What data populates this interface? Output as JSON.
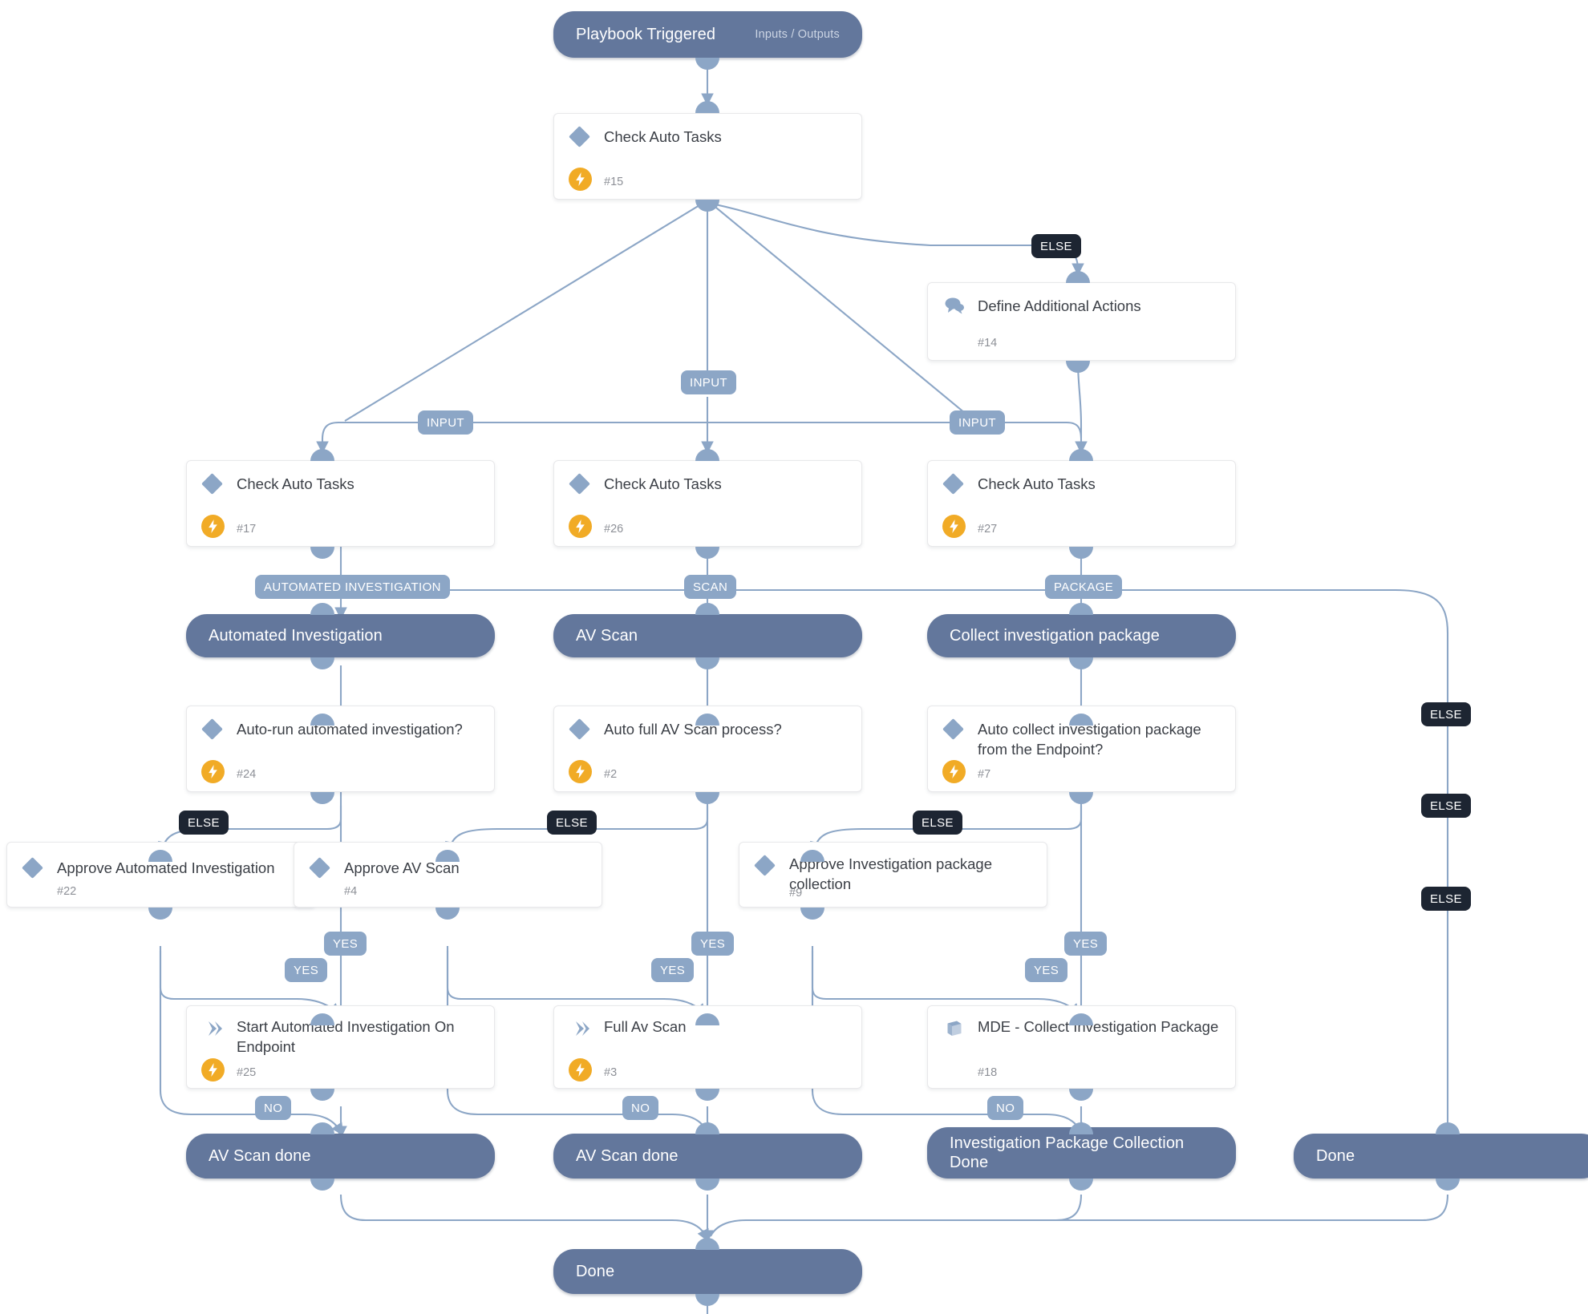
{
  "diagram": {
    "title": "Playbook Triggered",
    "type": "playbook-flow",
    "colors": {
      "pill_fill": "#63779c",
      "card_fill": "#ffffff",
      "port": "#8ca6c6",
      "edge": "#8ca6c6",
      "label_blue": "#8ca6c6",
      "label_dark": "#1d2532",
      "auto_badge": "#f1ab26"
    }
  },
  "nodes": {
    "trigger": {
      "label": "Playbook Triggered",
      "sub": "Inputs / Outputs",
      "kind": "pill"
    },
    "check15": {
      "label": "Check Auto Tasks",
      "id": "#15",
      "icon": "diamond-icon",
      "auto": true,
      "kind": "card"
    },
    "define14": {
      "label": "Define Additional Actions",
      "id": "#14",
      "icon": "speech-bubble-icon",
      "auto": false,
      "kind": "card"
    },
    "check17": {
      "label": "Check Auto Tasks",
      "id": "#17",
      "icon": "diamond-icon",
      "auto": true,
      "kind": "card"
    },
    "check26": {
      "label": "Check Auto Tasks",
      "id": "#26",
      "icon": "diamond-icon",
      "auto": true,
      "kind": "card"
    },
    "check27": {
      "label": "Check Auto Tasks",
      "id": "#27",
      "icon": "diamond-icon",
      "auto": true,
      "kind": "card"
    },
    "sec_ai": {
      "label": "Automated Investigation",
      "kind": "pill"
    },
    "sec_av": {
      "label": "AV Scan",
      "kind": "pill"
    },
    "sec_pkg": {
      "label": "Collect investigation package",
      "kind": "pill"
    },
    "cond24": {
      "label": "Auto-run automated investigation?",
      "id": "#24",
      "icon": "diamond-icon",
      "auto": true,
      "kind": "card"
    },
    "cond2": {
      "label": "Auto full AV Scan process?",
      "id": "#2",
      "icon": "diamond-icon",
      "auto": true,
      "kind": "card"
    },
    "cond7": {
      "label": "Auto collect investigation package from the Endpoint?",
      "id": "#7",
      "icon": "diamond-icon",
      "auto": true,
      "kind": "card"
    },
    "appr22": {
      "label": "Approve Automated Investigation",
      "id": "#22",
      "icon": "diamond-icon",
      "auto": false,
      "kind": "card"
    },
    "appr4": {
      "label": "Approve AV Scan",
      "id": "#4",
      "icon": "diamond-icon",
      "auto": false,
      "kind": "card"
    },
    "appr9": {
      "label": "Approve Investigation package collection",
      "id": "#9",
      "icon": "diamond-icon",
      "auto": false,
      "kind": "card"
    },
    "act25": {
      "label": "Start Automated Investigation On Endpoint",
      "id": "#25",
      "icon": "chevron-icon",
      "auto": true,
      "kind": "card"
    },
    "act3": {
      "label": "Full Av Scan",
      "id": "#3",
      "icon": "chevron-icon",
      "auto": true,
      "kind": "card"
    },
    "act18": {
      "label": "MDE - Collect Investigation Package",
      "id": "#18",
      "icon": "book-icon",
      "auto": false,
      "kind": "card"
    },
    "done_ai": {
      "label": "AV Scan done",
      "kind": "pill"
    },
    "done_av": {
      "label": "AV Scan done",
      "kind": "pill"
    },
    "done_pkg": {
      "label": "Investigation Package Collection\nDone",
      "kind": "pill"
    },
    "done_right": {
      "label": "Done",
      "kind": "pill"
    },
    "done_final": {
      "label": "Done",
      "kind": "pill"
    }
  },
  "edge_labels": {
    "else_top": "ELSE",
    "input_left": "INPUT",
    "input_mid": "INPUT",
    "input_right": "INPUT",
    "branch_ai": "AUTOMATED INVESTIGATION",
    "branch_scan": "SCAN",
    "branch_pkg": "PACKAGE",
    "else_ai": "ELSE",
    "else_av": "ELSE",
    "else_pkg": "ELSE",
    "else_r1": "ELSE",
    "else_r2": "ELSE",
    "else_r3": "ELSE",
    "yes_ai_cond": "YES",
    "yes_ai_appr": "YES",
    "no_ai": "NO",
    "yes_av_cond": "YES",
    "yes_av_appr": "YES",
    "no_av": "NO",
    "yes_pkg_cond": "YES",
    "yes_pkg_appr": "YES",
    "no_pkg": "NO"
  }
}
